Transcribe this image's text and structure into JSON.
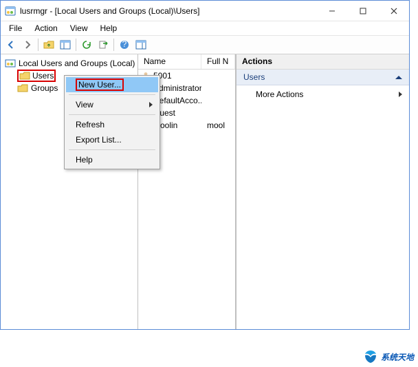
{
  "window": {
    "title": "lusrmgr - [Local Users and Groups (Local)\\Users]"
  },
  "menubar": {
    "file": "File",
    "action": "Action",
    "view": "View",
    "help": "Help"
  },
  "tree": {
    "root": "Local Users and Groups (Local)",
    "users": "Users",
    "groups": "Groups"
  },
  "list": {
    "columns": {
      "name": "Name",
      "fullname": "Full N"
    },
    "rows": [
      {
        "name": "5001",
        "full": ""
      },
      {
        "name": "Administrator",
        "full": ""
      },
      {
        "name": "DefaultAcco...",
        "full": ""
      },
      {
        "name": "Guest",
        "full": ""
      },
      {
        "name": "moolin",
        "full": "mool"
      }
    ]
  },
  "actions": {
    "header": "Actions",
    "group": "Users",
    "more": "More Actions"
  },
  "context_menu": {
    "new_user": "New User...",
    "view": "View",
    "refresh": "Refresh",
    "export": "Export List...",
    "help": "Help"
  },
  "watermark": "系统天地"
}
